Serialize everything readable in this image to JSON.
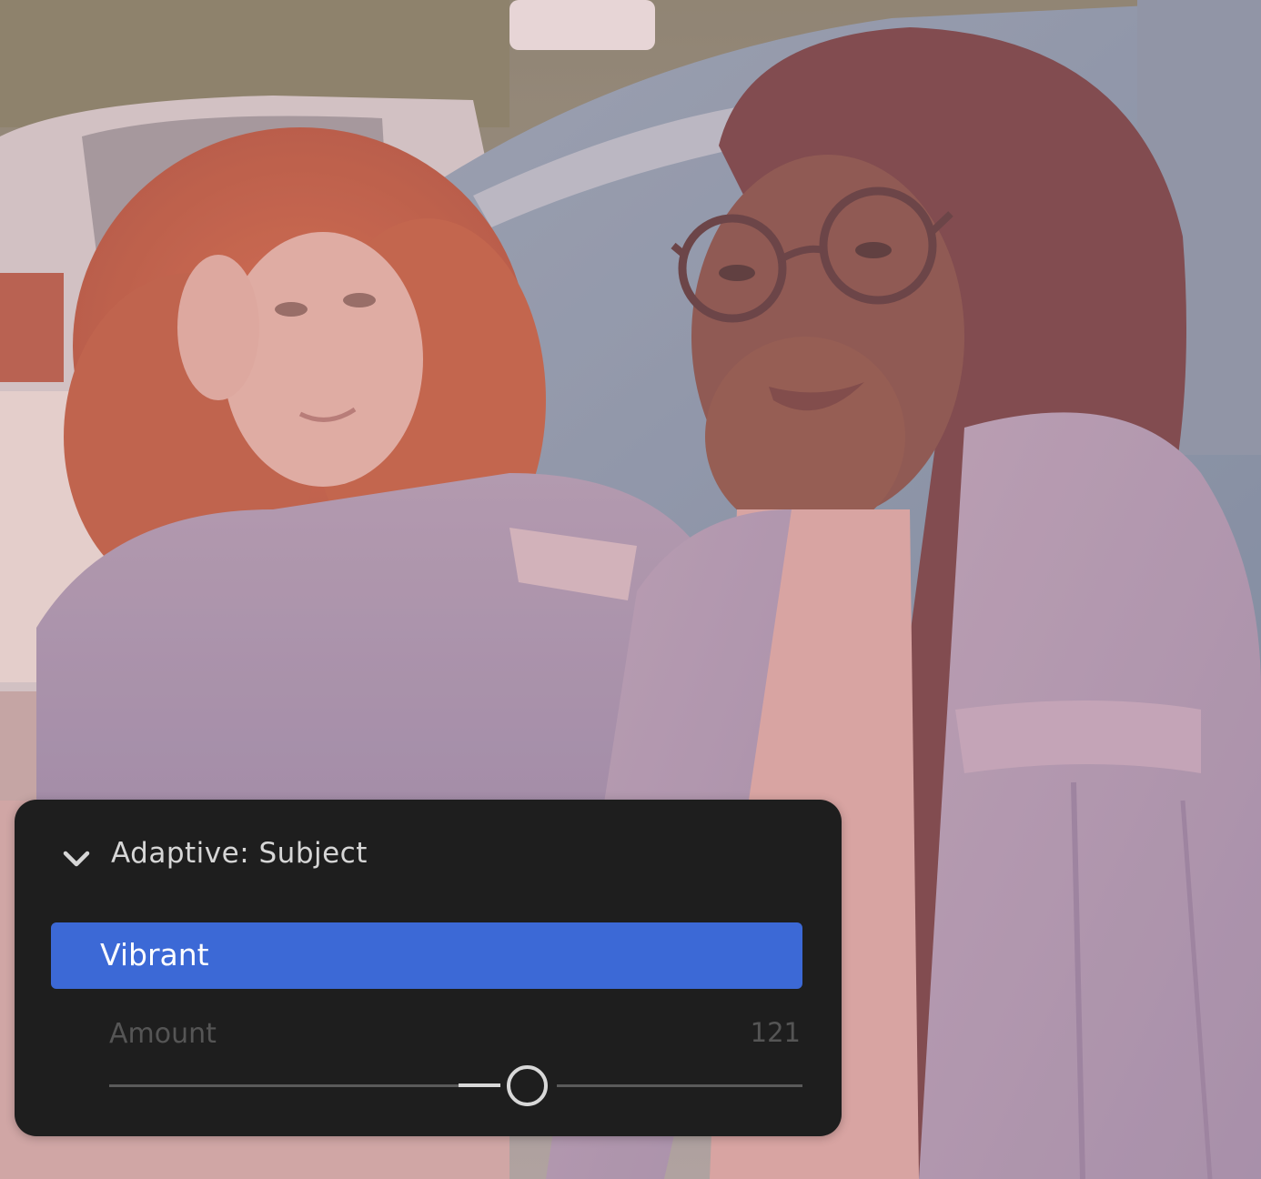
{
  "panel": {
    "title": "Adaptive: Subject",
    "expand_icon": "chevron-down-icon",
    "preset": {
      "label": "Vibrant",
      "selected": true,
      "highlight_color": "#3c69d6"
    },
    "amount": {
      "label": "Amount",
      "value": "121"
    }
  },
  "colors": {
    "panel_background": "#1e1e1e",
    "title_text": "#d6d6d6",
    "dim_text": "#555555"
  }
}
